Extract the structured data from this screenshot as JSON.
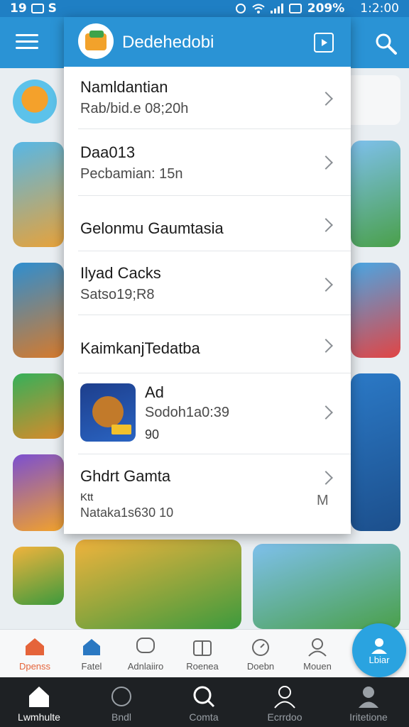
{
  "status_bar": {
    "left_text": "19",
    "left_letter": "S",
    "battery": "209%",
    "clock": "1:2:00"
  },
  "panel": {
    "title": "Dedehedobi",
    "rows": [
      {
        "title": "Namldantian",
        "subtitle": "Rab/bid.e 08;20h"
      },
      {
        "title": "Daa013",
        "subtitle": "Pecbamian: 15n"
      },
      {
        "title": "Gelonmu Gaumtasia"
      },
      {
        "title": "Ilyad Cacks",
        "subtitle": "Satso19;R8"
      },
      {
        "title": "KaimkanjTedatba"
      },
      {
        "title": "Ad",
        "subtitle": "Sodoh1a0:39",
        "extra": "90"
      },
      {
        "title": "Ghdrt Gamta",
        "subtitle": "Nataka1s630 10",
        "extra": "Ktt",
        "mark": "M"
      }
    ]
  },
  "app_tabs": [
    {
      "label": "Dpenss",
      "icon": "home-icon",
      "active": true
    },
    {
      "label": "Fatel",
      "icon": "house-icon"
    },
    {
      "label": "Adnlaiiro",
      "icon": "chat-bubble-icon"
    },
    {
      "label": "Roenea",
      "icon": "gift-icon"
    },
    {
      "label": "Doebn",
      "icon": "stopwatch-icon"
    },
    {
      "label": "Mouen",
      "icon": "people-icon"
    }
  ],
  "fab_label": "Lbiar",
  "sys_nav": [
    {
      "label": "Lwmhulte",
      "icon": "home-icon",
      "active": true
    },
    {
      "label": "Bndl",
      "icon": "chat-icon"
    },
    {
      "label": "Comta",
      "icon": "search-icon"
    },
    {
      "label": "Ecrrdoo",
      "icon": "person-icon"
    },
    {
      "label": "Iritetione",
      "icon": "profile-icon"
    }
  ],
  "colors": {
    "primary": "#2a93d5",
    "accent": "#e5643a",
    "nav_dark": "#1e2124"
  }
}
